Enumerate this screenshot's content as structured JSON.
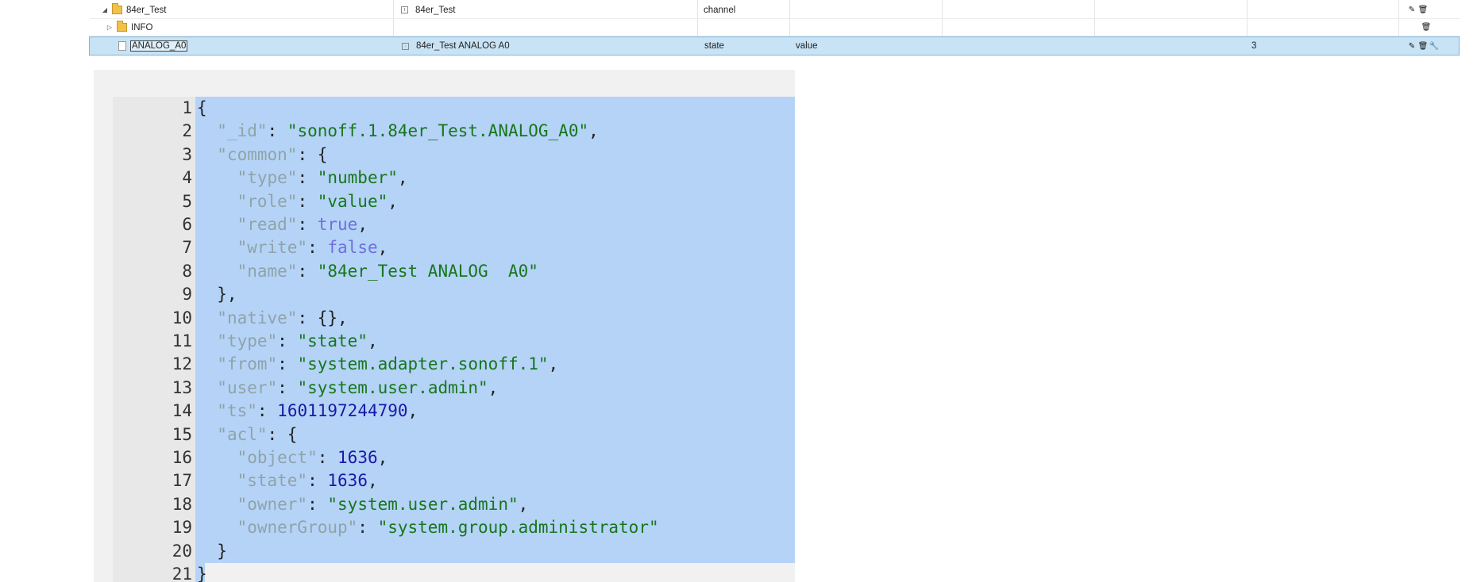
{
  "tree": {
    "rows": [
      {
        "toggle": "◢",
        "name": "84er_Test",
        "title": "84er_Test",
        "type": "channel",
        "role": "",
        "value": "",
        "actions": [
          "✎",
          "🗑"
        ]
      },
      {
        "toggle": "▷",
        "name": "INFO",
        "title": "",
        "type": "",
        "role": "",
        "value": "",
        "actions": [
          "🗑"
        ]
      },
      {
        "toggle": "",
        "name": "ANALOG_A0",
        "title": "84er_Test ANALOG A0",
        "type": "state",
        "role": "value",
        "value": "3",
        "actions": [
          "✎",
          "🗑",
          "🔧"
        ]
      }
    ]
  },
  "editor": {
    "line_numbers": [
      "1",
      "2",
      "3",
      "4",
      "5",
      "6",
      "7",
      "8",
      "9",
      "10",
      "11",
      "12",
      "13",
      "14",
      "15",
      "16",
      "17",
      "18",
      "19",
      "20",
      "21"
    ],
    "fold_marker": "▾",
    "lines": [
      [
        [
          "p",
          "{"
        ]
      ],
      [
        [
          "p",
          "  "
        ],
        [
          "k",
          "\"_id\""
        ],
        [
          "p",
          ": "
        ],
        [
          "s",
          "\"sonoff.1.84er_Test.ANALOG_A0\""
        ],
        [
          "p",
          ","
        ]
      ],
      [
        [
          "p",
          "  "
        ],
        [
          "k",
          "\"common\""
        ],
        [
          "p",
          ": {"
        ]
      ],
      [
        [
          "p",
          "    "
        ],
        [
          "k",
          "\"type\""
        ],
        [
          "p",
          ": "
        ],
        [
          "s",
          "\"number\""
        ],
        [
          "p",
          ","
        ]
      ],
      [
        [
          "p",
          "    "
        ],
        [
          "k",
          "\"role\""
        ],
        [
          "p",
          ": "
        ],
        [
          "s",
          "\"value\""
        ],
        [
          "p",
          ","
        ]
      ],
      [
        [
          "p",
          "    "
        ],
        [
          "k",
          "\"read\""
        ],
        [
          "p",
          ": "
        ],
        [
          "b",
          "true"
        ],
        [
          "p",
          ","
        ]
      ],
      [
        [
          "p",
          "    "
        ],
        [
          "k",
          "\"write\""
        ],
        [
          "p",
          ": "
        ],
        [
          "b",
          "false"
        ],
        [
          "p",
          ","
        ]
      ],
      [
        [
          "p",
          "    "
        ],
        [
          "k",
          "\"name\""
        ],
        [
          "p",
          ": "
        ],
        [
          "s",
          "\"84er_Test ANALOG  A0\""
        ]
      ],
      [
        [
          "p",
          "  },"
        ]
      ],
      [
        [
          "p",
          "  "
        ],
        [
          "k",
          "\"native\""
        ],
        [
          "p",
          ": {},"
        ]
      ],
      [
        [
          "p",
          "  "
        ],
        [
          "k",
          "\"type\""
        ],
        [
          "p",
          ": "
        ],
        [
          "s",
          "\"state\""
        ],
        [
          "p",
          ","
        ]
      ],
      [
        [
          "p",
          "  "
        ],
        [
          "k",
          "\"from\""
        ],
        [
          "p",
          ": "
        ],
        [
          "s",
          "\"system.adapter.sonoff.1\""
        ],
        [
          "p",
          ","
        ]
      ],
      [
        [
          "p",
          "  "
        ],
        [
          "k",
          "\"user\""
        ],
        [
          "p",
          ": "
        ],
        [
          "s",
          "\"system.user.admin\""
        ],
        [
          "p",
          ","
        ]
      ],
      [
        [
          "p",
          "  "
        ],
        [
          "k",
          "\"ts\""
        ],
        [
          "p",
          ": "
        ],
        [
          "n",
          "1601197244790"
        ],
        [
          "p",
          ","
        ]
      ],
      [
        [
          "p",
          "  "
        ],
        [
          "k",
          "\"acl\""
        ],
        [
          "p",
          ": {"
        ]
      ],
      [
        [
          "p",
          "    "
        ],
        [
          "k",
          "\"object\""
        ],
        [
          "p",
          ": "
        ],
        [
          "n",
          "1636"
        ],
        [
          "p",
          ","
        ]
      ],
      [
        [
          "p",
          "    "
        ],
        [
          "k",
          "\"state\""
        ],
        [
          "p",
          ": "
        ],
        [
          "n",
          "1636"
        ],
        [
          "p",
          ","
        ]
      ],
      [
        [
          "p",
          "    "
        ],
        [
          "k",
          "\"owner\""
        ],
        [
          "p",
          ": "
        ],
        [
          "s",
          "\"system.user.admin\""
        ],
        [
          "p",
          ","
        ]
      ],
      [
        [
          "p",
          "    "
        ],
        [
          "k",
          "\"ownerGroup\""
        ],
        [
          "p",
          ": "
        ],
        [
          "s",
          "\"system.group.administrator\""
        ]
      ],
      [
        [
          "p",
          "  }"
        ]
      ],
      [
        [
          "p",
          "}"
        ]
      ]
    ],
    "colors": {
      "selection": "#b4d3f7",
      "key": "#8fa3a8",
      "string": "#17761c",
      "boolean": "#6f6fe0",
      "number": "#1a1aa6"
    }
  }
}
